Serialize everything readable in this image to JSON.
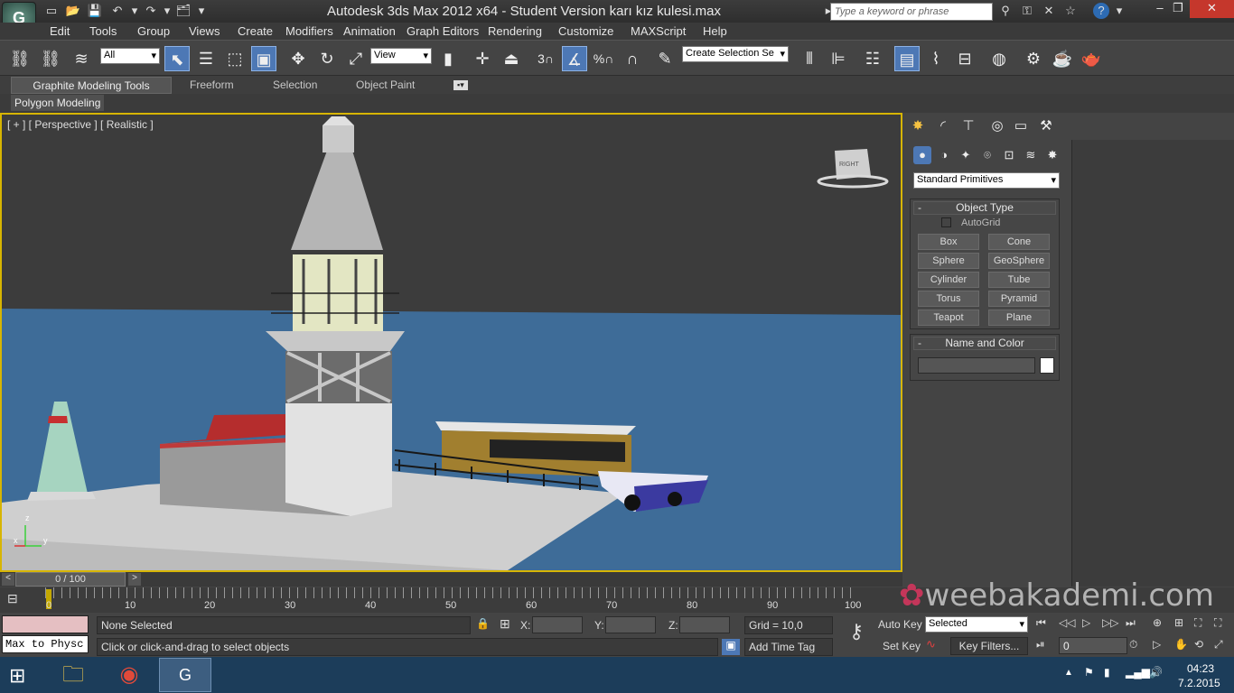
{
  "titlebar": {
    "title": "Autodesk 3ds Max  2012 x64   - Student Version    karı kız kulesi.max",
    "search_placeholder": "Type a keyword or phrase",
    "minimize": "–",
    "maximize": "❐",
    "close": "✕"
  },
  "app_logo": "3ds-max-logo",
  "menubar": [
    "Edit",
    "Tools",
    "Group",
    "Views",
    "Create",
    "Modifiers",
    "Animation",
    "Graph Editors",
    "Rendering",
    "Customize",
    "MAXScript",
    "Help"
  ],
  "toolbar": {
    "selection_filter": "All",
    "ref_coord": "View",
    "named_selection": "Create Selection Se",
    "snap_value": "3",
    "angle_snap": "%"
  },
  "ribbon": {
    "tabs": [
      "Graphite Modeling Tools",
      "Freeform",
      "Selection",
      "Object Paint"
    ],
    "active_tab": "Graphite Modeling Tools",
    "panel": "Polygon Modeling"
  },
  "viewport": {
    "label": "[ + ] [ Perspective ] [ Realistic ]",
    "viewcube_label": "RIGHT",
    "axis_x": "x",
    "axis_y": "y",
    "axis_z": "z",
    "colors": {
      "sky": "#3c3c3c",
      "sea": "#3e6c98",
      "ground": "#d4d4d4",
      "active_border": "#d7b500"
    }
  },
  "command_panel": {
    "category_dropdown": "Standard Primitives",
    "object_type": {
      "title": "Object Type",
      "autogrid_label": "AutoGrid",
      "buttons": [
        "Box",
        "Cone",
        "Sphere",
        "GeoSphere",
        "Cylinder",
        "Tube",
        "Torus",
        "Pyramid",
        "Teapot",
        "Plane"
      ]
    },
    "name_color": {
      "title": "Name and Color",
      "name_value": "",
      "swatch_color": "#ffffff"
    }
  },
  "timeslider": {
    "frame": "0 / 100",
    "prev": "<",
    "next": ">"
  },
  "timeline": {
    "ticks": [
      "0",
      "10",
      "20",
      "30",
      "40",
      "50",
      "60",
      "70",
      "80",
      "90",
      "100"
    ]
  },
  "status": {
    "maxscript_listener": "Max to Physc",
    "selection_info": "None Selected",
    "prompt": "Click or click-and-drag to select objects",
    "x_label": "X:",
    "y_label": "Y:",
    "z_label": "Z:",
    "grid": "Grid = 10,0",
    "add_time_tag": "Add Time Tag",
    "auto_key": "Auto Key",
    "set_key": "Set Key",
    "key_mode_dropdown": "Selected",
    "key_filters": "Key Filters...",
    "current_frame": "0"
  },
  "watermark": "weebakademi.com",
  "taskbar": {
    "time": "04:23",
    "date": "7.2.2015"
  }
}
